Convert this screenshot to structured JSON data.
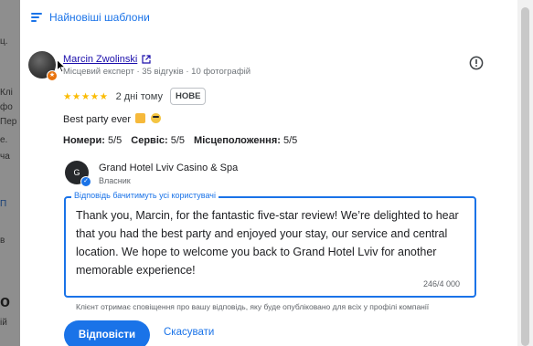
{
  "background": {
    "fragments": [
      "ц.",
      "Клі",
      "фо",
      "Пер",
      "е.",
      "ча",
      "П",
      "в",
      "о",
      "ій"
    ]
  },
  "sort": {
    "label": "Найновіші шаблони"
  },
  "review": {
    "reviewer_name": "Marcin Zwolinski",
    "reviewer_meta": "Місцевий експерт · 35 відгуків · 10 фотографій",
    "stars": "★★★★★",
    "date": "2 дні тому",
    "badge": "НОВЕ",
    "text": "Best party ever",
    "subratings": [
      {
        "label": "Номери:",
        "value": "5/5"
      },
      {
        "label": "Сервіс:",
        "value": "5/5"
      },
      {
        "label": "Місцеположення:",
        "value": "5/5"
      }
    ]
  },
  "owner": {
    "name": "Grand Hotel Lviv Casino & Spa",
    "role": "Власник"
  },
  "reply": {
    "label": "Відповідь бачитимуть усі користувачі",
    "text": "Thank you, Marcin, for the fantastic five-star review! We’re delighted to hear that you had the best party and enjoyed your stay, our service and central location. We hope to welcome you back to Grand Hotel Lviv for another memorable experience!",
    "char_count": "246/4 000",
    "notice": "Клієнт отримає сповіщення про вашу відповідь, яку буде опубліковано для всіх у профілі компанії"
  },
  "actions": {
    "reply_label": "Відповісти",
    "cancel_label": "Скасувати"
  }
}
